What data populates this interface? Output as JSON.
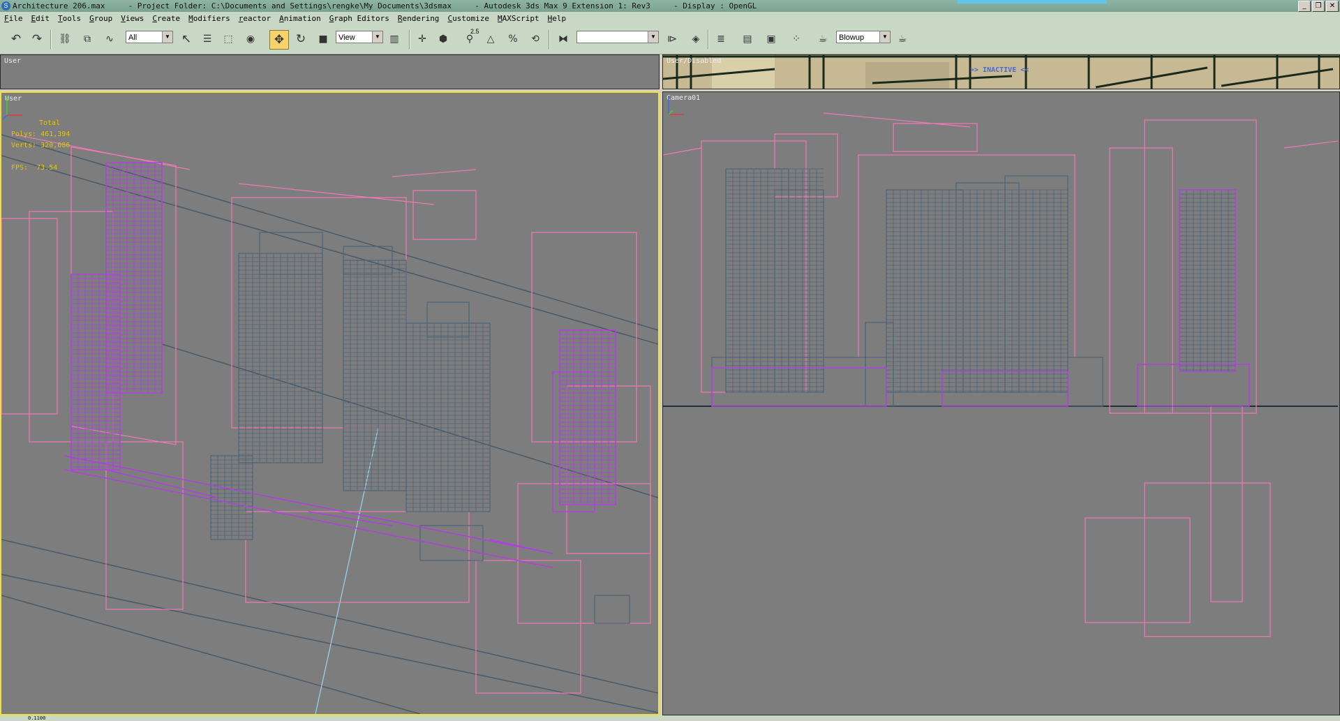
{
  "window": {
    "title": "Architecture 206.max     - Project Folder: C:\\Documents and Settings\\rengke\\My Documents\\3dsmax     - Autodesk 3ds Max 9 Extension 1: Rev3     - Display : OpenGL",
    "minimize": "_",
    "restore": "❐",
    "close": "✕"
  },
  "menu": [
    "File",
    "Edit",
    "Tools",
    "Group",
    "Views",
    "Create",
    "Modifiers",
    "reactor",
    "Animation",
    "Graph Editors",
    "Rendering",
    "Customize",
    "MAXScript",
    "Help"
  ],
  "toolbar": {
    "selection_filter": "All",
    "reference_coord": "View",
    "named_selection": "",
    "render_preset": "Blowup",
    "icons": [
      "undo-icon",
      "redo-icon",
      "select-link-icon",
      "unlink-icon",
      "bind-spacewarp-icon",
      "select-object-icon",
      "select-by-name-icon",
      "rect-select-icon",
      "window-crossing-icon",
      "move-icon",
      "rotate-icon",
      "scale-icon",
      "pivot-icon",
      "manipulate-icon",
      "snap-icon",
      "angle-snap-icon",
      "percent-snap-icon",
      "spinner-snap-icon",
      "edit-named-sets-icon",
      "mirror-icon",
      "align-icon",
      "layer-manager-icon",
      "curve-editor-icon",
      "schematic-icon",
      "material-editor-icon",
      "render-scene-icon",
      "quick-render-icon"
    ],
    "snap_value": "2.5"
  },
  "viewports": {
    "top_left": {
      "label": "User"
    },
    "top_right": {
      "label": "User/Disabled",
      "inactive": ">> INACTIVE <<"
    },
    "user": {
      "label": "User"
    },
    "camera": {
      "label": "Camera01"
    }
  },
  "stats": {
    "header": "Total",
    "polys_label": "Polys:",
    "polys_value": "461,394",
    "verts_label": "Verts:",
    "verts_value": "320,086",
    "fps_label": "FPS:",
    "fps_value": "73.54"
  },
  "status": {
    "coord": "0.1100"
  },
  "colors": {
    "viewport_bg": "#7d7d7d",
    "active_border": "#f1e03a",
    "wire_pink": "#f07ab4",
    "wire_purple": "#b040e0",
    "wire_steel": "#4e6478",
    "stats_text": "#e0c800"
  }
}
